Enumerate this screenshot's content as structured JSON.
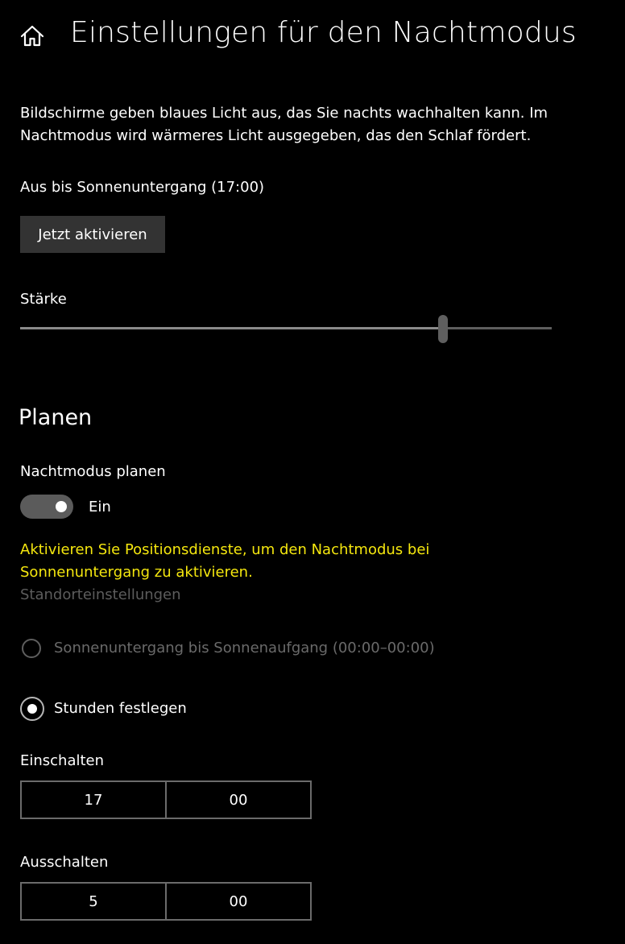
{
  "header": {
    "title": "Einstellungen für den Nachtmodus",
    "home_icon": "home-icon"
  },
  "description_line1": "Bildschirme geben blaues Licht aus, das Sie nachts wachhalten kann. Im",
  "description_line2": "Nachtmodus wird wärmeres Licht ausgegeben, das den Schlaf fördert.",
  "status": "Aus bis Sonnenuntergang (17:00)",
  "activate_button": "Jetzt aktivieren",
  "strength": {
    "label": "Stärke",
    "value_fraction": 0.795
  },
  "schedule": {
    "section_title": "Planen",
    "label": "Nachtmodus planen",
    "toggle_on": true,
    "toggle_text": "Ein",
    "warning_line1": "Aktivieren Sie Positionsdienste, um den Nachtmodus bei",
    "warning_line2": "Sonnenuntergang zu aktivieren.",
    "location_link": "Standorteinstellungen",
    "option_sunset": "Sonnenuntergang bis Sonnenaufgang (00:00–00:00)",
    "option_hours": "Stunden festlegen",
    "selected_option": "hours",
    "on_label": "Einschalten",
    "on_hour": "17",
    "on_minute": "00",
    "off_label": "Ausschalten",
    "off_hour": "5",
    "off_minute": "00"
  },
  "colors": {
    "background": "#000000",
    "warning": "#f5e70e",
    "disabled_text": "#6a6a6a",
    "button": "#333333"
  }
}
